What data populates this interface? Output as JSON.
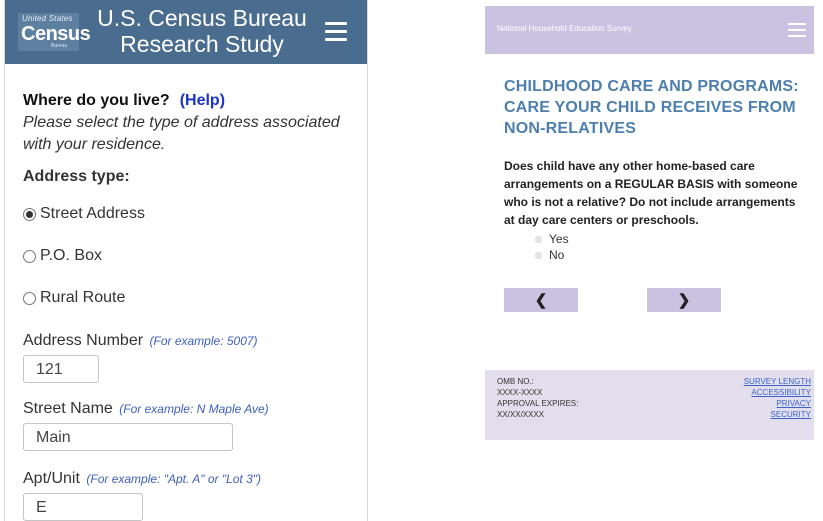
{
  "left": {
    "logo": {
      "small": "United States",
      "main": "Census",
      "sub": "Bureau"
    },
    "header_title": "U.S. Census Bureau Research Study",
    "question": "Where do you live?",
    "help": "(Help)",
    "description": "Please select the type of address associated with your residence.",
    "address_type_label": "Address type:",
    "options": [
      "Street Address",
      "P.O. Box",
      "Rural Route"
    ],
    "selected_option": "Street Address",
    "fields": {
      "number": {
        "label": "Address Number",
        "example": "(For example: 5007)",
        "value": "121"
      },
      "street": {
        "label": "Street Name",
        "example": "(For example: N Maple Ave)",
        "value": "Main"
      },
      "apt": {
        "label": "Apt/Unit",
        "example": "(For example: \"Apt. A\" or \"Lot 3\")",
        "value": "E"
      }
    }
  },
  "right": {
    "header_title": "National Household Education Survey",
    "section_title": "CHILDHOOD CARE AND PROGRAMS: CARE YOUR CHILD RECEIVES FROM NON-RELATIVES",
    "question": "Does child have any other home-based care arrangements on a REGULAR BASIS with someone who is not a relative? Do not include arrangements at day care centers or preschools.",
    "options": [
      "Yes",
      "No"
    ],
    "nav": {
      "back": "❮",
      "next": "❯"
    },
    "footer": {
      "omb_label": "OMB NO.:",
      "omb_value": "XXXX-XXXX",
      "approval_label": "APPROVAL EXPIRES:",
      "approval_value": "XX/XX/XXXX",
      "links": [
        "SURVEY LENGTH",
        "ACCESSIBILITY",
        "PRIVACY",
        "SECURITY"
      ]
    }
  },
  "colors": {
    "census_header": "#4a6d8f",
    "nhes_header": "#c9c2e0",
    "help_link": "#1a33c9",
    "example_text": "#3d5fc1",
    "section_title": "#4d7fae",
    "footer_link": "#3a64c9"
  }
}
